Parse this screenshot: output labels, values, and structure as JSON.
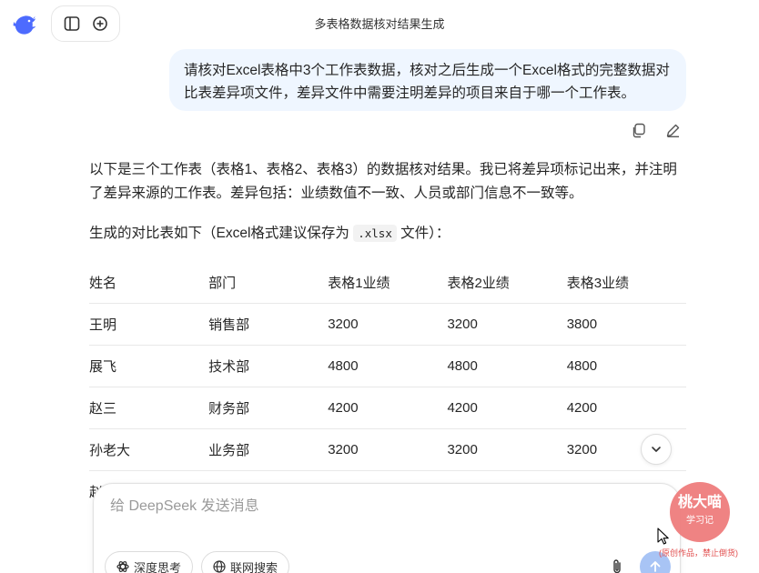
{
  "header": {
    "title": "多表格数据核对结果生成",
    "logo_icon": "deepseek-whale-icon",
    "sidebar_toggle_icon": "sidebar-toggle-icon",
    "new_chat_icon": "new-chat-icon"
  },
  "user_message": {
    "text": "请核对Excel表格中3个工作表数据，核对之后生成一个Excel格式的完整数据对比表差异项文件，差异文件中需要注明差异的项目来自于哪一个工作表。",
    "copy_icon": "copy-icon",
    "edit_icon": "edit-icon"
  },
  "answer": {
    "para1": "以下是三个工作表（表格1、表格2、表格3）的数据核对结果。我已将差异项标记出来，并注明了差异来源的工作表。差异包括：业绩数值不一致、人员或部门信息不一致等。",
    "para2_before": "生成的对比表如下（Excel格式建议保存为",
    "para2_code": ".xlsx",
    "para2_after": "文件）：",
    "table": {
      "headers": [
        "姓名",
        "部门",
        "表格1业绩",
        "表格2业绩",
        "表格3业绩"
      ],
      "rows": [
        [
          "王明",
          "销售部",
          "3200",
          "3200",
          "3800"
        ],
        [
          "展飞",
          "技术部",
          "4800",
          "4800",
          "4800"
        ],
        [
          "赵三",
          "财务部",
          "4200",
          "4200",
          "4200"
        ],
        [
          "孙老大",
          "业务部",
          "3200",
          "3200",
          "3200"
        ]
      ],
      "partial_row_text": "赵"
    }
  },
  "composer": {
    "placeholder": "给 DeepSeek 发送消息",
    "deep_think_label": "深度思考",
    "web_search_label": "联网搜索",
    "attach_icon": "paperclip-icon",
    "send_icon": "arrow-up-icon"
  },
  "watermark": {
    "name": "桃大喵",
    "sub": "学习记",
    "note": "(原创作品，禁止倒货)"
  },
  "colors": {
    "user_bubble": "#eff6ff",
    "send_button": "#a8c4f5",
    "brand": "#4d6bfe",
    "watermark": "#ef7d7d"
  }
}
